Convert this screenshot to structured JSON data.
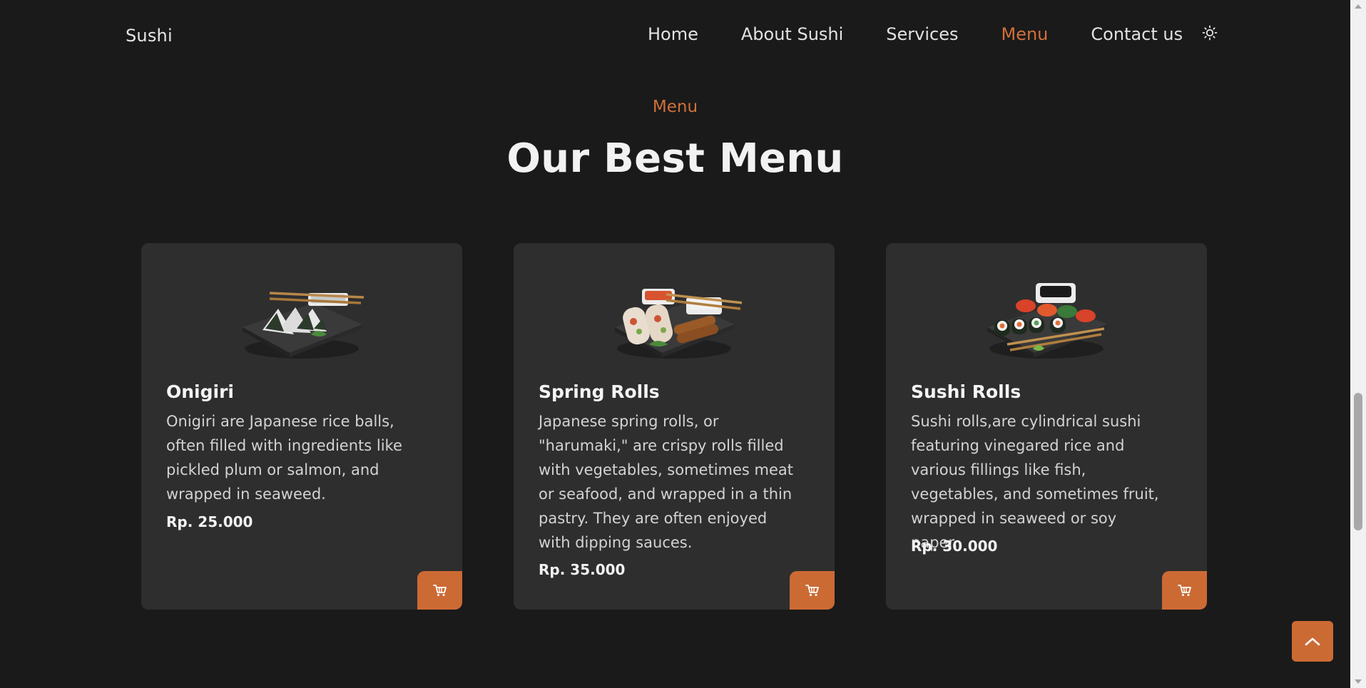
{
  "header": {
    "logo": "Sushi",
    "nav": [
      {
        "label": "Home"
      },
      {
        "label": "About Sushi"
      },
      {
        "label": "Services"
      },
      {
        "label": "Menu"
      },
      {
        "label": "Contact us"
      }
    ],
    "active_nav": "Menu",
    "theme_icon": "sun-icon"
  },
  "section": {
    "eyebrow": "Menu",
    "title": "Our Best Menu"
  },
  "menu": {
    "items": [
      {
        "title": "Onigiri",
        "description": "Onigiri are Japanese rice balls, often filled with ingredients like pickled plum or salmon, and wrapped in seaweed.",
        "price": "Rp. 25.000",
        "image_icon": "onigiri-plate-image",
        "cart_icon": "cart-icon"
      },
      {
        "title": "Spring Rolls",
        "description": "Japanese spring rolls, or \"harumaki,\" are crispy rolls filled with vegetables, sometimes meat or seafood, and wrapped in a thin pastry. They are often enjoyed with dipping sauces.",
        "price": "Rp. 35.000",
        "image_icon": "spring-rolls-plate-image",
        "cart_icon": "cart-icon"
      },
      {
        "title": "Sushi Rolls",
        "description": "Sushi rolls,are cylindrical sushi featuring vinegared rice and various fillings like fish, vegetables, and sometimes fruit, wrapped in seaweed or soy paper.",
        "price": "Rp. 30.000",
        "image_icon": "sushi-rolls-plate-image",
        "cart_icon": "cart-icon"
      }
    ]
  },
  "scroll_top_icon": "chevron-up-icon",
  "colors": {
    "accent": "#d2703a",
    "background": "#1a1a1a",
    "card": "#2e2e2e",
    "button": "#cc6a34"
  }
}
